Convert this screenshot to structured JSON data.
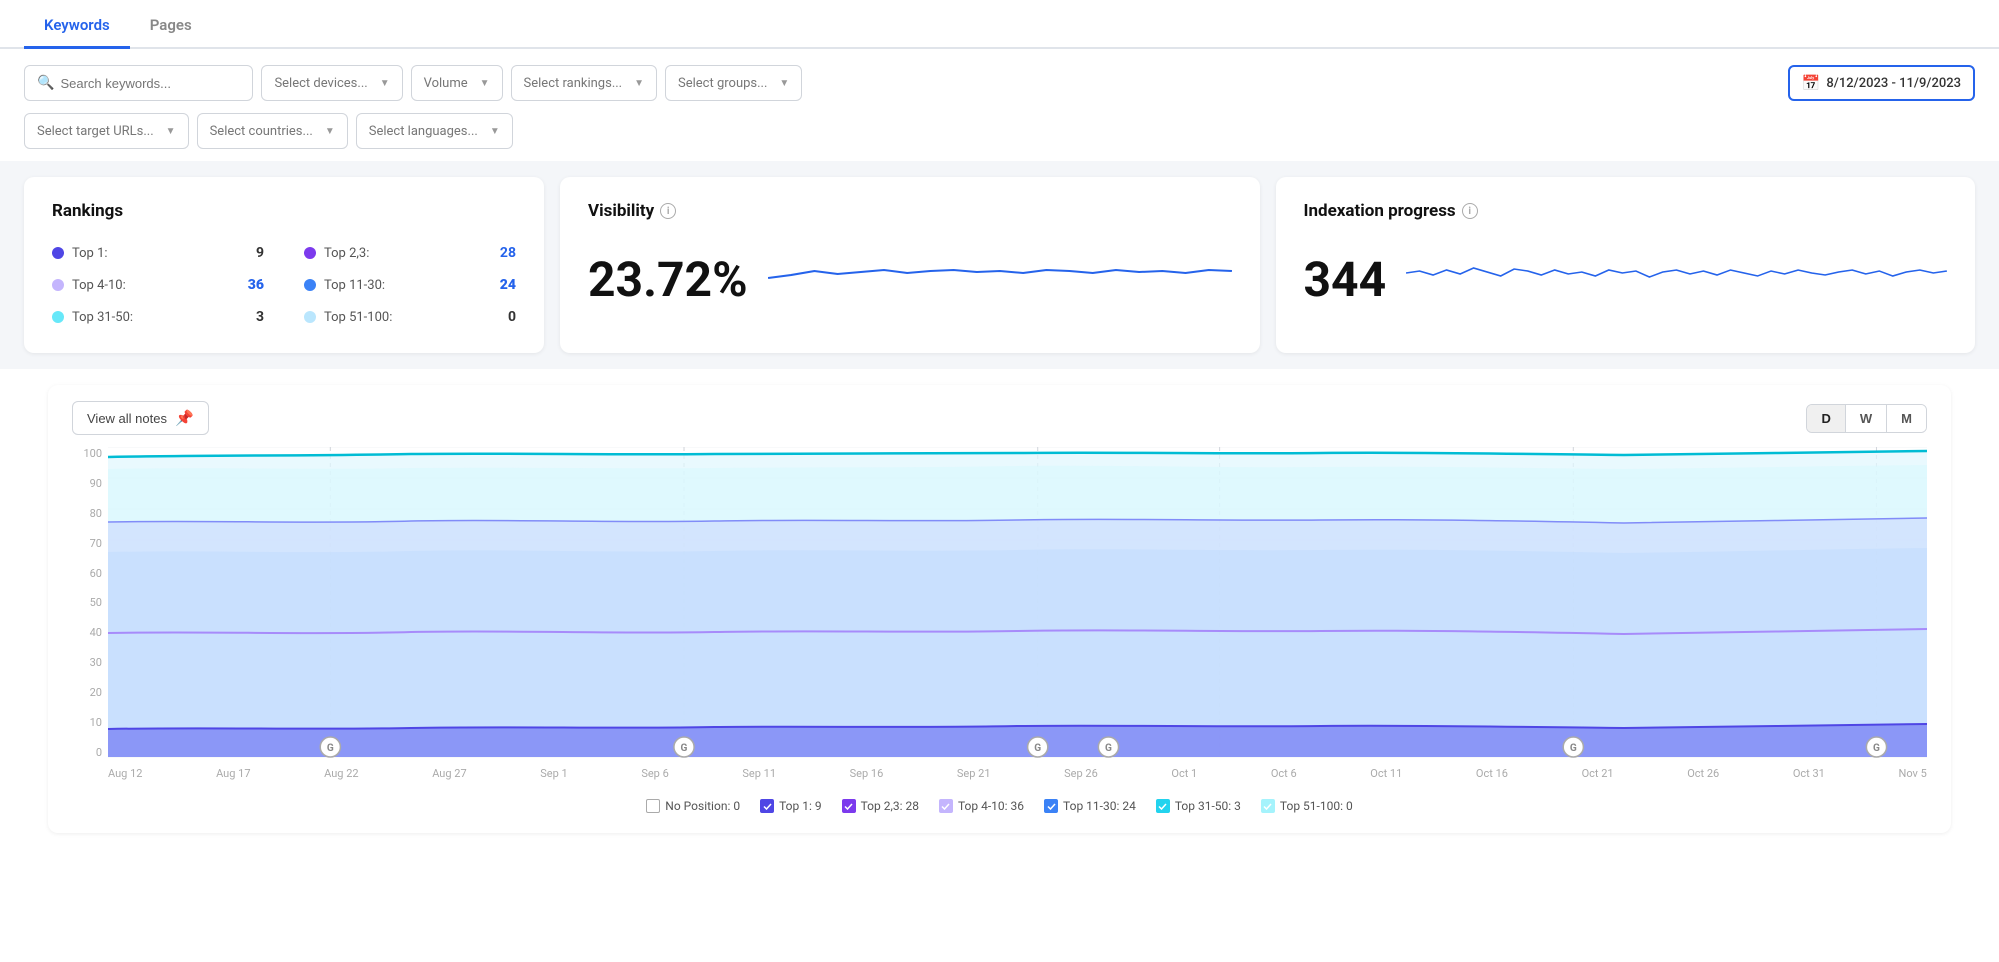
{
  "tabs": [
    {
      "id": "keywords",
      "label": "Keywords",
      "active": true
    },
    {
      "id": "pages",
      "label": "Pages",
      "active": false
    }
  ],
  "filters": {
    "search_placeholder": "Search keywords...",
    "devices_placeholder": "Select devices...",
    "volume_placeholder": "Volume",
    "rankings_placeholder": "Select rankings...",
    "groups_placeholder": "Select groups...",
    "target_urls_placeholder": "Select target URLs...",
    "countries_placeholder": "Select countries...",
    "languages_placeholder": "Select languages...",
    "date_range": "8/12/2023 - 11/9/2023"
  },
  "rankings": {
    "title": "Rankings",
    "items": [
      {
        "label": "Top 1:",
        "value": "9",
        "color": "#4f46e5",
        "bold": false
      },
      {
        "label": "Top 2,3:",
        "value": "28",
        "color": "#7c3aed",
        "bold": false
      },
      {
        "label": "Top 4-10:",
        "value": "36",
        "color": "#c4b5fd",
        "bold": true
      },
      {
        "label": "Top 11-30:",
        "value": "24",
        "color": "#3b82f6",
        "bold": true
      },
      {
        "label": "Top 31-50:",
        "value": "3",
        "color": "#67e8f9",
        "bold": false
      },
      {
        "label": "Top 51-100:",
        "value": "0",
        "color": "#bae6fd",
        "bold": false
      }
    ]
  },
  "visibility": {
    "title": "Visibility",
    "value": "23.72%"
  },
  "indexation": {
    "title": "Indexation progress",
    "value": "344"
  },
  "chart": {
    "view_notes_label": "View all notes",
    "period_buttons": [
      "D",
      "W",
      "M"
    ],
    "active_period": "D",
    "y_labels": [
      "0",
      "10",
      "20",
      "30",
      "40",
      "50",
      "60",
      "70",
      "80",
      "90",
      "100"
    ],
    "x_labels": [
      "Aug 12",
      "Aug 17",
      "Aug 22",
      "Aug 27",
      "Sep 1",
      "Sep 6",
      "Sep 11",
      "Sep 16",
      "Sep 21",
      "Sep 26",
      "Oct 1",
      "Oct 6",
      "Oct 11",
      "Oct 16",
      "Oct 21",
      "Oct 26",
      "Oct 31",
      "Nov 5"
    ]
  },
  "legend": {
    "items": [
      {
        "label": "No Position: 0",
        "checked": false,
        "color": "none"
      },
      {
        "label": "Top 1: 9",
        "checked": true,
        "color": "blue"
      },
      {
        "label": "Top 2,3: 28",
        "checked": true,
        "color": "purple"
      },
      {
        "label": "Top 4-10: 36",
        "checked": true,
        "color": "light-purple"
      },
      {
        "label": "Top 11-30: 24",
        "checked": true,
        "color": "cyan"
      },
      {
        "label": "Top 31-50: 3",
        "checked": true,
        "color": "light-cyan"
      },
      {
        "label": "Top 51-100: 0",
        "checked": true,
        "color": "light-blue"
      }
    ]
  }
}
